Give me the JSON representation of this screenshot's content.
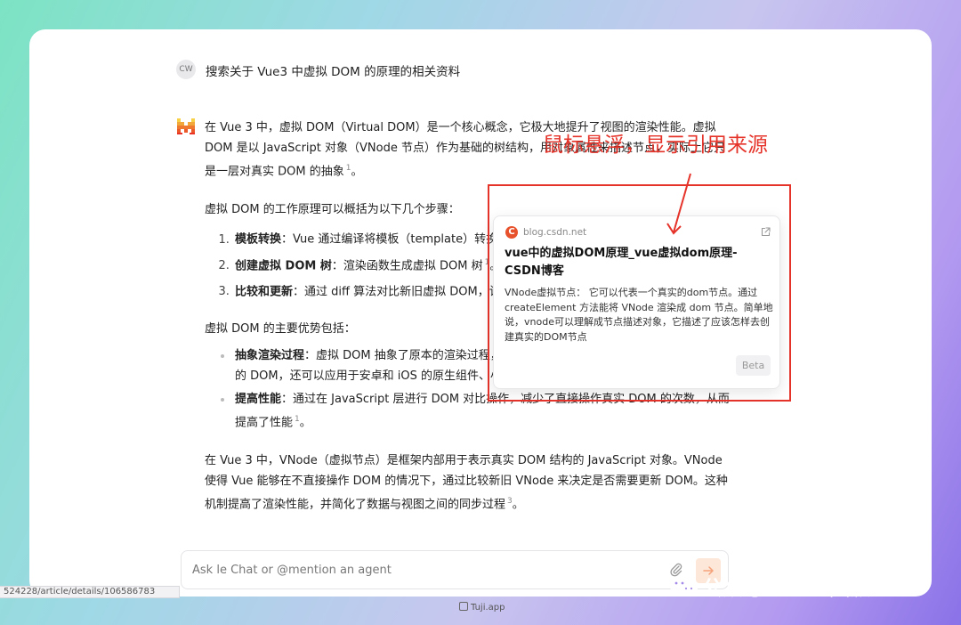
{
  "user": {
    "avatar_initials": "CW",
    "message": "搜索关于 Vue3 中虚拟 DOM 的原理的相关资料"
  },
  "answer": {
    "intro": "在 Vue 3 中，虚拟 DOM（Virtual DOM）是一个核心概念，它极大地提升了视图的渲染性能。虚拟 DOM 是以 JavaScript 对象（VNode 节点）作为基础的树结构，用对象属性来描述节点，实际上它只是一层对真实 DOM 的抽象",
    "intro_ref": "1",
    "steps_heading": "虚拟 DOM 的工作原理可以概括为以下几个步骤：",
    "steps": [
      {
        "title": "模板转换",
        "text": "：Vue 通过编译将模板（template）转换成渲染函数（render function）",
        "ref": "1",
        "end": "。"
      },
      {
        "title": "创建虚拟 DOM 树",
        "text": "：渲染函数生成虚拟 DOM 树",
        "ref": "1",
        "end": "。"
      },
      {
        "title": "比较和更新",
        "text": "：通过 diff 算法对比新旧虚拟 DOM，记录差异，然后将差异更新到真实 DOM",
        "ref": "1",
        "end": "。"
      }
    ],
    "advantages_heading": "虚拟 DOM 的主要优势包括：",
    "advantages": [
      {
        "title": "抽象渲染过程",
        "text": "：虚拟 DOM 抽象了原本的渲染过程，实现了跨平台的能力，不仅可以应用于浏览器的 DOM，还可以应用于安卓和 iOS 的原生组件、小程序等",
        "ref": "",
        "end": ""
      },
      {
        "title": "提高性能",
        "text": "：通过在 JavaScript 层进行 DOM 对比操作，减少了直接操作真实 DOM 的次数，从而提高了性能",
        "ref": "1",
        "end": "。"
      }
    ],
    "summary": "在 Vue 3 中，VNode（虚拟节点）是框架内部用于表示真实 DOM 结构的 JavaScript 对象。VNode 使得 Vue 能够在不直接操作 DOM 的情况下，通过比较新旧 VNode 来决定是否需要更新 DOM。这种机制提高了渲染性能，并简化了数据与视图之间的同步过程",
    "summary_ref": "3",
    "summary_end": "。"
  },
  "annotation": {
    "text": "鼠标悬浮，显示引用来源",
    "color": "#e5332a"
  },
  "citation_popup": {
    "favicon_letter": "C",
    "domain": "blog.csdn.net",
    "title": "vue中的虚拟DOM原理_vue虚拟dom原理-CSDN博客",
    "body": "VNode虚拟节点： 它可以代表一个真实的dom节点。通过 createElement 方法能将 VNode 渲染成 dom 节点。简单地说，vnode可以理解成节点描述对象，它描述了应该怎样去创建真实的DOM节点",
    "badge": "Beta"
  },
  "composer": {
    "placeholder": "Ask le Chat or @mention an agent"
  },
  "status_url": "524228/article/details/106586783",
  "footer": {
    "tuji": "Tuji.app",
    "watermark": "公众号 · AI工具派"
  }
}
